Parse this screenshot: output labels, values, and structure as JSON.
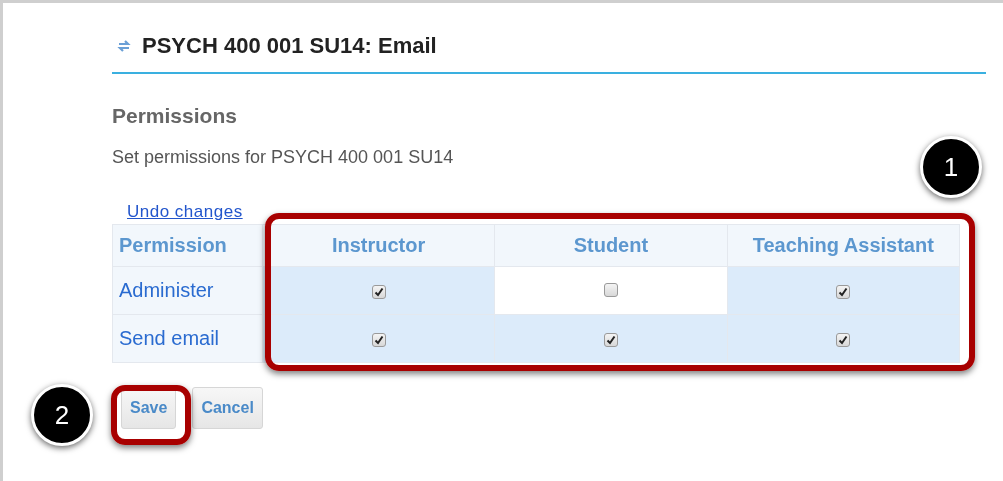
{
  "header": {
    "title": "PSYCH 400 001 SU14: Email"
  },
  "section": {
    "heading": "Permissions",
    "description": "Set permissions for PSYCH 400 001 SU14"
  },
  "undo_link": "Undo changes",
  "table": {
    "columns": [
      "Permission",
      "Instructor",
      "Student",
      "Teaching Assistant"
    ],
    "rows": [
      {
        "permission": "Administer",
        "checks": [
          {
            "checked": true
          },
          {
            "checked": false
          },
          {
            "checked": true
          }
        ]
      },
      {
        "permission": "Send email",
        "checks": [
          {
            "checked": true
          },
          {
            "checked": true
          },
          {
            "checked": true
          }
        ]
      }
    ]
  },
  "buttons": [
    {
      "label": "Save"
    },
    {
      "label": "Cancel"
    }
  ],
  "callouts": [
    {
      "label": "1"
    },
    {
      "label": "2"
    }
  ]
}
